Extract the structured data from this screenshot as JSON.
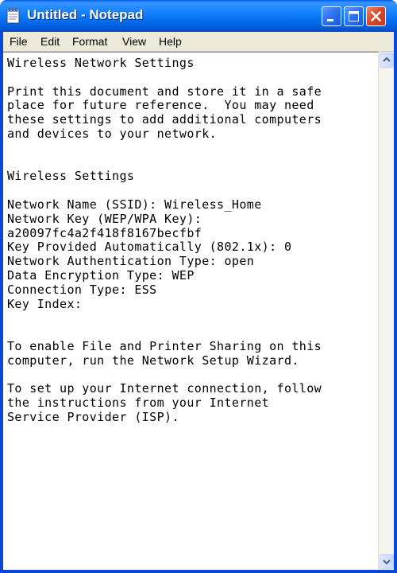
{
  "window": {
    "title": "Untitled - Notepad",
    "icon": "notepad-icon",
    "controls": [
      "minimize-icon",
      "maximize-icon",
      "close-icon"
    ],
    "colors": {
      "titlebar": "#127dff",
      "close_button": "#d9482a",
      "menubar": "#ece9d8"
    }
  },
  "menu": {
    "file": "File",
    "edit": "Edit",
    "format": "Format",
    "view": "View",
    "help": "Help"
  },
  "editor": {
    "text": "Wireless Network Settings\n\nPrint this document and store it in a safe\nplace for future reference.  You may need\nthese settings to add additional computers\nand devices to your network.\n\n\nWireless Settings\n\nNetwork Name (SSID): Wireless_Home\nNetwork Key (WEP/WPA Key):\na20097fc4a2f418f8167becfbf\nKey Provided Automatically (802.1x): 0\nNetwork Authentication Type: open\nData Encryption Type: WEP\nConnection Type: ESS\nKey Index:\n\n\nTo enable File and Printer Sharing on this\ncomputer, run the Network Setup Wizard.\n\nTo set up your Internet connection, follow\nthe instructions from your Internet\nService Provider (ISP)."
  },
  "scrollbar": {
    "icons": [
      "scroll-up-arrow-icon",
      "scroll-down-arrow-icon"
    ]
  }
}
